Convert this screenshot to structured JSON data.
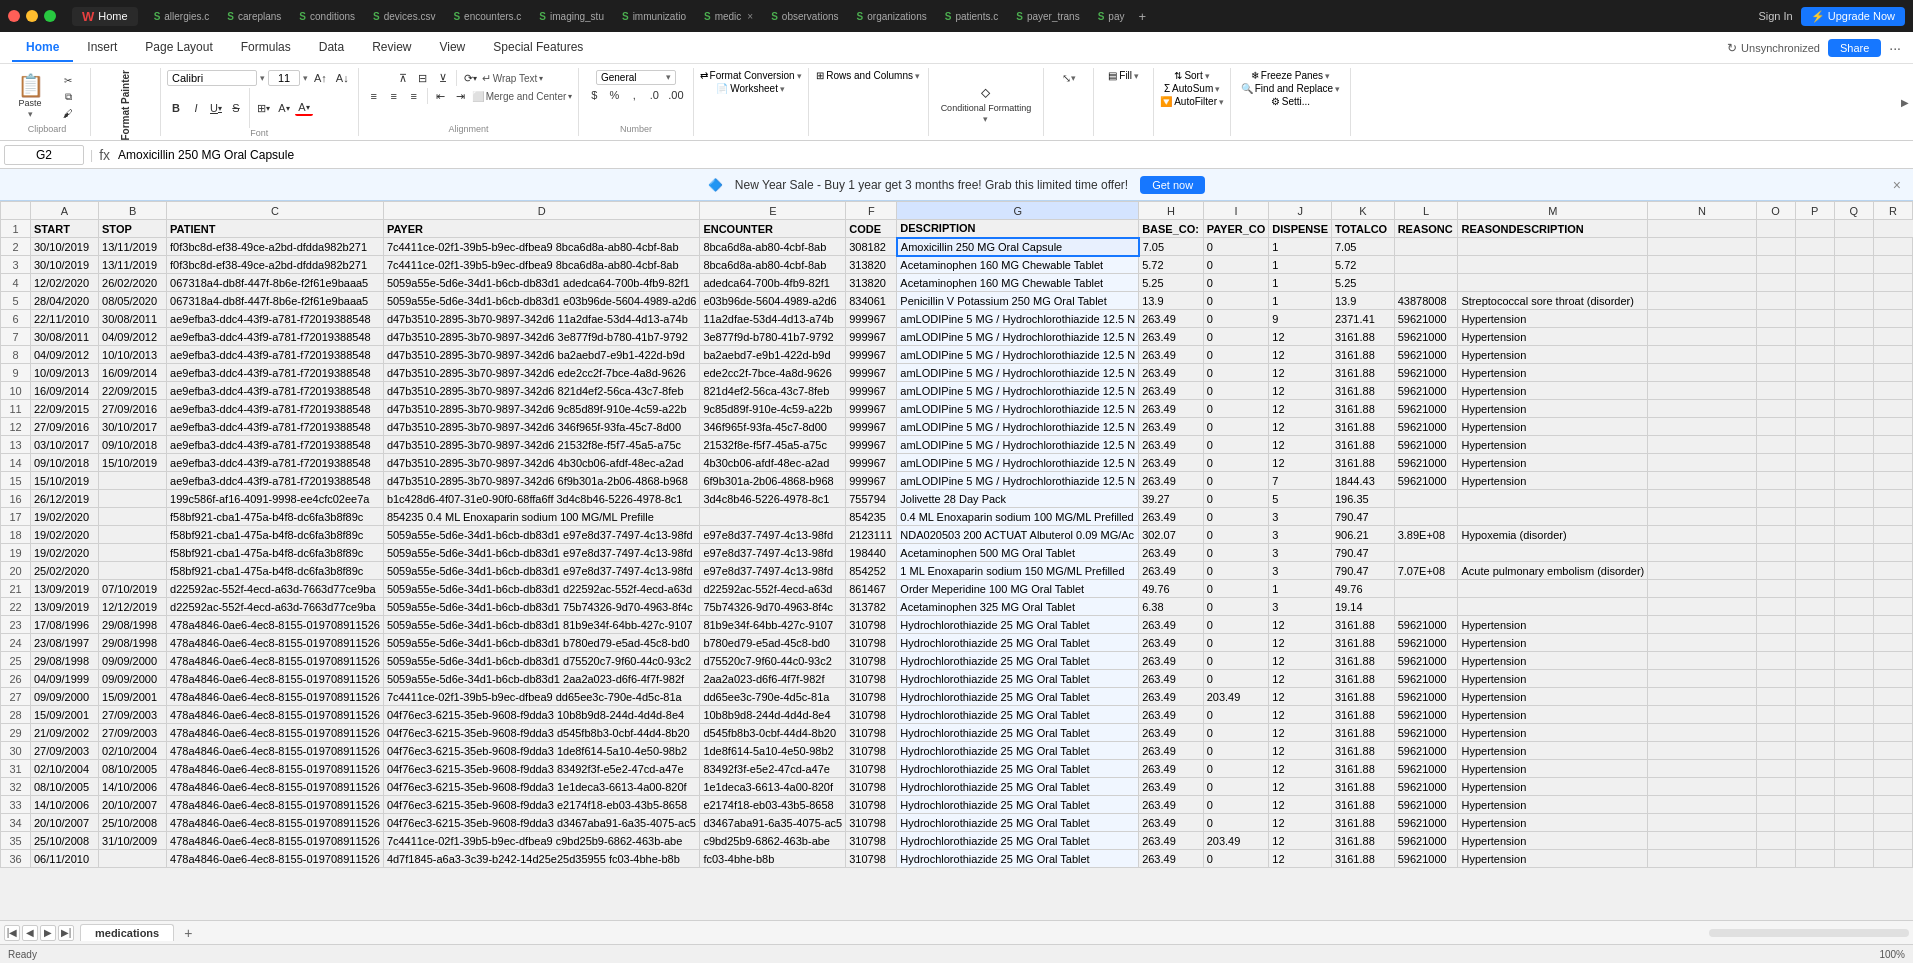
{
  "titleBar": {
    "trafficLights": [
      "red",
      "yellow",
      "green"
    ],
    "appName": "Home",
    "tabs": [
      {
        "id": "home",
        "label": "Home",
        "icon": "S",
        "active": true
      },
      {
        "id": "allergies",
        "label": "allergies.c",
        "icon": "S"
      },
      {
        "id": "careplans",
        "label": "careplans",
        "icon": "S"
      },
      {
        "id": "conditions",
        "label": "conditions",
        "icon": "S"
      },
      {
        "id": "devices",
        "label": "devices.csv",
        "icon": "S"
      },
      {
        "id": "encounters",
        "label": "encounters.c",
        "icon": "S"
      },
      {
        "id": "imaging_stu",
        "label": "imaging_stu",
        "icon": "S"
      },
      {
        "id": "immunization",
        "label": "immunizatio",
        "icon": "S"
      },
      {
        "id": "medic",
        "label": "medic",
        "icon": "S",
        "hasClose": true
      },
      {
        "id": "observations",
        "label": "observations",
        "icon": "S"
      },
      {
        "id": "organizations",
        "label": "organizations",
        "icon": "S"
      },
      {
        "id": "patients",
        "label": "patients.c",
        "icon": "S"
      },
      {
        "id": "payer_trans",
        "label": "payer_trans",
        "icon": "S"
      },
      {
        "id": "pay",
        "label": "pay",
        "icon": "S"
      }
    ],
    "signIn": "Sign In",
    "upgradeNow": "⚡ Upgrade Now"
  },
  "ribbonTabs": {
    "tabs": [
      "Home",
      "Insert",
      "Page Layout",
      "Formulas",
      "Data",
      "Review",
      "View",
      "Special Features"
    ],
    "activeTab": "Home",
    "unsyncLabel": "Unsynchronized",
    "shareLabel": "Share",
    "moreBtn": "···"
  },
  "ribbonGroups": {
    "formatPainter": "Format Painter",
    "paste": "Paste",
    "clipboard": "Clipboard",
    "fontName": "Calibri",
    "fontSize": "11",
    "bold": "B",
    "italic": "I",
    "underline": "U",
    "strikethrough": "S",
    "font": "Font",
    "wrapText": "Wrap Text",
    "mergeCenter": "Merge and Center",
    "alignment": "Alignment",
    "formatConversion": "Format Conversion",
    "worksheet": "Worksheet",
    "rowsAndColumns": "Rows and Columns",
    "conditionalFormatting": "Conditional Formatting",
    "fill": "Fill",
    "sort": "Sort",
    "autoSum": "AutoSum",
    "autoFilter": "AutoFilter",
    "freezePanes": "Freeze Panes",
    "findReplace": "Find and Replace",
    "settings": "Setti..."
  },
  "formulaBar": {
    "cellRef": "G2",
    "formula": "Amoxicillin 250 MG Oral Capsule"
  },
  "promoBanner": {
    "text": "🔷 New Year Sale - Buy 1 year get 3 months free! Grab this limited time offer!",
    "btnLabel": "Get now"
  },
  "columns": [
    "",
    "A",
    "B",
    "C",
    "D",
    "E",
    "F",
    "G",
    "H",
    "I",
    "J",
    "K",
    "L",
    "M",
    "N",
    "O",
    "P",
    "Q",
    "R"
  ],
  "headerRow": {
    "cells": [
      "",
      "START",
      "STOP",
      "PATIENT",
      "PAYER",
      "ENCOUNTER",
      "CODE",
      "DESCRIPTION",
      "BASE_CO:",
      "PAYER_CO",
      "DISPENSE",
      "TOTALCO",
      "REASONC",
      "REASONDESCRIPTION",
      "",
      "",
      "",
      "",
      ""
    ]
  },
  "rows": [
    [
      "2",
      "30/10/2019",
      "13/11/2019",
      "f0f3bc8d-ef38-49ce-a2bd-dfdda982b271",
      "7c4411ce-02f1-39b5-b9ec-dfbea9 8bca6d8a-ab80-4cbf-8ab",
      "8bca6d8a-ab80-4cbf-8ab",
      "308182",
      "Amoxicillin 250 MG Oral Capsule",
      "7.05",
      "0",
      "1",
      "7.05",
      "",
      "",
      "",
      "",
      "",
      "",
      ""
    ],
    [
      "3",
      "30/10/2019",
      "13/11/2019",
      "f0f3bc8d-ef38-49ce-a2bd-dfdda982b271",
      "7c4411ce-02f1-39b5-b9ec-dfbea9 8bca6d8a-ab80-4cbf-8ab",
      "8bca6d8a-ab80-4cbf-8ab",
      "313820",
      "Acetaminophen 160 MG Chewable Tablet",
      "5.72",
      "0",
      "1",
      "5.72",
      "",
      "",
      "",
      "",
      "",
      "",
      ""
    ],
    [
      "4",
      "12/02/2020",
      "26/02/2020",
      "067318a4-db8f-447f-8b6e-f2f61e9baaa5",
      "5059a55e-5d6e-34d1-b6cb-db83d1 adedca64-700b-4fb9-82f1",
      "adedca64-700b-4fb9-82f1",
      "313820",
      "Acetaminophen 160 MG Chewable Tablet",
      "5.25",
      "0",
      "1",
      "5.25",
      "",
      "",
      "",
      "",
      "",
      "",
      ""
    ],
    [
      "5",
      "28/04/2020",
      "08/05/2020",
      "067318a4-db8f-447f-8b6e-f2f61e9baaa5",
      "5059a55e-5d6e-34d1-b6cb-db83d1 e03b96de-5604-4989-a2d6",
      "e03b96de-5604-4989-a2d6",
      "834061",
      "Penicillin V Potassium 250 MG Oral Tablet",
      "13.9",
      "0",
      "1",
      "13.9",
      "43878008",
      "Streptococcal sore throat (disorder)",
      "",
      "",
      "",
      "",
      ""
    ],
    [
      "6",
      "22/11/2010",
      "30/08/2011",
      "ae9efba3-ddc4-43f9-a781-f72019388548",
      "d47b3510-2895-3b70-9897-342d6 11a2dfae-53d4-4d13-a74b",
      "11a2dfae-53d4-4d13-a74b",
      "999967",
      "amLODIPine 5 MG / Hydrochlorothiazide 12.5 N",
      "263.49",
      "0",
      "9",
      "2371.41",
      "59621000",
      "Hypertension",
      "",
      "",
      "",
      "",
      ""
    ],
    [
      "7",
      "30/08/2011",
      "04/09/2012",
      "ae9efba3-ddc4-43f9-a781-f72019388548",
      "d47b3510-2895-3b70-9897-342d6 3e877f9d-b780-41b7-9792",
      "3e877f9d-b780-41b7-9792",
      "999967",
      "amLODIPine 5 MG / Hydrochlorothiazide 12.5 N",
      "263.49",
      "0",
      "12",
      "3161.88",
      "59621000",
      "Hypertension",
      "",
      "",
      "",
      "",
      ""
    ],
    [
      "8",
      "04/09/2012",
      "10/10/2013",
      "ae9efba3-ddc4-43f9-a781-f72019388548",
      "d47b3510-2895-3b70-9897-342d6 ba2aebd7-e9b1-422d-b9d",
      "ba2aebd7-e9b1-422d-b9d",
      "999967",
      "amLODIPine 5 MG / Hydrochlorothiazide 12.5 N",
      "263.49",
      "0",
      "12",
      "3161.88",
      "59621000",
      "Hypertension",
      "",
      "",
      "",
      "",
      ""
    ],
    [
      "9",
      "10/09/2013",
      "16/09/2014",
      "ae9efba3-ddc4-43f9-a781-f72019388548",
      "d47b3510-2895-3b70-9897-342d6 ede2cc2f-7bce-4a8d-9626",
      "ede2cc2f-7bce-4a8d-9626",
      "999967",
      "amLODIPine 5 MG / Hydrochlorothiazide 12.5 N",
      "263.49",
      "0",
      "12",
      "3161.88",
      "59621000",
      "Hypertension",
      "",
      "",
      "",
      "",
      ""
    ],
    [
      "10",
      "16/09/2014",
      "22/09/2015",
      "ae9efba3-ddc4-43f9-a781-f72019388548",
      "d47b3510-2895-3b70-9897-342d6 821d4ef2-56ca-43c7-8feb",
      "821d4ef2-56ca-43c7-8feb",
      "999967",
      "amLODIPine 5 MG / Hydrochlorothiazide 12.5 N",
      "263.49",
      "0",
      "12",
      "3161.88",
      "59621000",
      "Hypertension",
      "",
      "",
      "",
      "",
      ""
    ],
    [
      "11",
      "22/09/2015",
      "27/09/2016",
      "ae9efba3-ddc4-43f9-a781-f72019388548",
      "d47b3510-2895-3b70-9897-342d6 9c85d89f-910e-4c59-a22b",
      "9c85d89f-910e-4c59-a22b",
      "999967",
      "amLODIPine 5 MG / Hydrochlorothiazide 12.5 N",
      "263.49",
      "0",
      "12",
      "3161.88",
      "59621000",
      "Hypertension",
      "",
      "",
      "",
      "",
      ""
    ],
    [
      "12",
      "27/09/2016",
      "30/10/2017",
      "ae9efba3-ddc4-43f9-a781-f72019388548",
      "d47b3510-2895-3b70-9897-342d6 346f965f-93fa-45c7-8d00",
      "346f965f-93fa-45c7-8d00",
      "999967",
      "amLODIPine 5 MG / Hydrochlorothiazide 12.5 N",
      "263.49",
      "0",
      "12",
      "3161.88",
      "59621000",
      "Hypertension",
      "",
      "",
      "",
      "",
      ""
    ],
    [
      "13",
      "03/10/2017",
      "09/10/2018",
      "ae9efba3-ddc4-43f9-a781-f72019388548",
      "d47b3510-2895-3b70-9897-342d6 21532f8e-f5f7-45a5-a75c",
      "21532f8e-f5f7-45a5-a75c",
      "999967",
      "amLODIPine 5 MG / Hydrochlorothiazide 12.5 N",
      "263.49",
      "0",
      "12",
      "3161.88",
      "59621000",
      "Hypertension",
      "",
      "",
      "",
      "",
      ""
    ],
    [
      "14",
      "09/10/2018",
      "15/10/2019",
      "ae9efba3-ddc4-43f9-a781-f72019388548",
      "d47b3510-2895-3b70-9897-342d6 4b30cb06-afdf-48ec-a2ad",
      "4b30cb06-afdf-48ec-a2ad",
      "999967",
      "amLODIPine 5 MG / Hydrochlorothiazide 12.5 N",
      "263.49",
      "0",
      "12",
      "3161.88",
      "59621000",
      "Hypertension",
      "",
      "",
      "",
      "",
      ""
    ],
    [
      "15",
      "15/10/2019",
      "",
      "ae9efba3-ddc4-43f9-a781-f72019388548",
      "d47b3510-2895-3b70-9897-342d6 6f9b301a-2b06-4868-b968",
      "6f9b301a-2b06-4868-b968",
      "999967",
      "amLODIPine 5 MG / Hydrochlorothiazide 12.5 N",
      "263.49",
      "0",
      "7",
      "1844.43",
      "59621000",
      "Hypertension",
      "",
      "",
      "",
      "",
      ""
    ],
    [
      "16",
      "26/12/2019",
      "",
      "199c586f-af16-4091-9998-ee4cfc02ee7a",
      "b1c428d6-4f07-31e0-90f0-68ffa6ff 3d4c8b46-5226-4978-8c1",
      "3d4c8b46-5226-4978-8c1",
      "755794",
      "Jolivette 28 Day Pack",
      "39.27",
      "0",
      "5",
      "196.35",
      "",
      "",
      "",
      "",
      "",
      "",
      ""
    ],
    [
      "17",
      "19/02/2020",
      "",
      "f58bf921-cba1-475a-b4f8-dc6fa3b8f89c",
      "854235 0.4 ML Enoxaparin sodium 100 MG/ML Prefille",
      "",
      "854235",
      "0.4 ML Enoxaparin sodium 100 MG/ML Prefilled",
      "263.49",
      "0",
      "3",
      "790.47",
      "",
      "",
      "",
      "",
      "",
      "",
      ""
    ],
    [
      "18",
      "19/02/2020",
      "",
      "f58bf921-cba1-475a-b4f8-dc6fa3b8f89c",
      "5059a55e-5d6e-34d1-b6cb-db83d1 e97e8d37-7497-4c13-98fd",
      "e97e8d37-7497-4c13-98fd",
      "2123111",
      "NDA020503 200 ACTUAT Albuterol 0.09 MG/Ac",
      "302.07",
      "0",
      "3",
      "906.21",
      "3.89E+08",
      "Hypoxemia (disorder)",
      "",
      "",
      "",
      "",
      ""
    ],
    [
      "19",
      "19/02/2020",
      "",
      "f58bf921-cba1-475a-b4f8-dc6fa3b8f89c",
      "5059a55e-5d6e-34d1-b6cb-db83d1 e97e8d37-7497-4c13-98fd",
      "e97e8d37-7497-4c13-98fd",
      "198440",
      "Acetaminophen 500 MG Oral Tablet",
      "263.49",
      "0",
      "3",
      "790.47",
      "",
      "",
      "",
      "",
      "",
      "",
      ""
    ],
    [
      "20",
      "25/02/2020",
      "",
      "f58bf921-cba1-475a-b4f8-dc6fa3b8f89c",
      "5059a55e-5d6e-34d1-b6cb-db83d1 e97e8d37-7497-4c13-98fd",
      "e97e8d37-7497-4c13-98fd",
      "854252",
      "1 ML Enoxaparin sodium 150 MG/ML Prefilled",
      "263.49",
      "0",
      "3",
      "790.47",
      "7.07E+08",
      "Acute pulmonary embolism (disorder)",
      "",
      "",
      "",
      "",
      ""
    ],
    [
      "21",
      "13/09/2019",
      "07/10/2019",
      "d22592ac-552f-4ecd-a63d-7663d77ce9ba",
      "5059a55e-5d6e-34d1-b6cb-db83d1 d22592ac-552f-4ecd-a63d",
      "d22592ac-552f-4ecd-a63d",
      "861467",
      "Order Meperidine 100 MG Oral Tablet",
      "49.76",
      "0",
      "1",
      "49.76",
      "",
      "",
      "",
      "",
      "",
      "",
      ""
    ],
    [
      "22",
      "13/09/2019",
      "12/12/2019",
      "d22592ac-552f-4ecd-a63d-7663d77ce9ba",
      "5059a55e-5d6e-34d1-b6cb-db83d1 75b74326-9d70-4963-8f4c",
      "75b74326-9d70-4963-8f4c",
      "313782",
      "Acetaminophen 325 MG Oral Tablet",
      "6.38",
      "0",
      "3",
      "19.14",
      "",
      "",
      "",
      "",
      "",
      "",
      ""
    ],
    [
      "23",
      "17/08/1996",
      "29/08/1998",
      "478a4846-0ae6-4ec8-8155-019708911526",
      "5059a55e-5d6e-34d1-b6cb-db83d1 81b9e34f-64bb-427c-9107",
      "81b9e34f-64bb-427c-9107",
      "310798",
      "Hydrochlorothiazide 25 MG Oral Tablet",
      "263.49",
      "0",
      "12",
      "3161.88",
      "59621000",
      "Hypertension",
      "",
      "",
      "",
      "",
      ""
    ],
    [
      "24",
      "23/08/1997",
      "29/08/1998",
      "478a4846-0ae6-4ec8-8155-019708911526",
      "5059a55e-5d6e-34d1-b6cb-db83d1 b780ed79-e5ad-45c8-bd0",
      "b780ed79-e5ad-45c8-bd0",
      "310798",
      "Hydrochlorothiazide 25 MG Oral Tablet",
      "263.49",
      "0",
      "12",
      "3161.88",
      "59621000",
      "Hypertension",
      "",
      "",
      "",
      "",
      ""
    ],
    [
      "25",
      "29/08/1998",
      "09/09/2000",
      "478a4846-0ae6-4ec8-8155-019708911526",
      "5059a55e-5d6e-34d1-b6cb-db83d1 d75520c7-9f60-44c0-93c2",
      "d75520c7-9f60-44c0-93c2",
      "310798",
      "Hydrochlorothiazide 25 MG Oral Tablet",
      "263.49",
      "0",
      "12",
      "3161.88",
      "59621000",
      "Hypertension",
      "",
      "",
      "",
      "",
      ""
    ],
    [
      "26",
      "04/09/1999",
      "09/09/2000",
      "478a4846-0ae6-4ec8-8155-019708911526",
      "5059a55e-5d6e-34d1-b6cb-db83d1 2aa2a023-d6f6-4f7f-982f",
      "2aa2a023-d6f6-4f7f-982f",
      "310798",
      "Hydrochlorothiazide 25 MG Oral Tablet",
      "263.49",
      "0",
      "12",
      "3161.88",
      "59621000",
      "Hypertension",
      "",
      "",
      "",
      "",
      ""
    ],
    [
      "27",
      "09/09/2000",
      "15/09/2001",
      "478a4846-0ae6-4ec8-8155-019708911526",
      "7c4411ce-02f1-39b5-b9ec-dfbea9 dd65ee3c-790e-4d5c-81a",
      "dd65ee3c-790e-4d5c-81a",
      "310798",
      "Hydrochlorothiazide 25 MG Oral Tablet",
      "263.49",
      "203.49",
      "12",
      "3161.88",
      "59621000",
      "Hypertension",
      "",
      "",
      "",
      "",
      ""
    ],
    [
      "28",
      "15/09/2001",
      "27/09/2003",
      "478a4846-0ae6-4ec8-8155-019708911526",
      "04f76ec3-6215-35eb-9608-f9dda3 10b8b9d8-244d-4d4d-8e4",
      "10b8b9d8-244d-4d4d-8e4",
      "310798",
      "Hydrochlorothiazide 25 MG Oral Tablet",
      "263.49",
      "0",
      "12",
      "3161.88",
      "59621000",
      "Hypertension",
      "",
      "",
      "",
      "",
      ""
    ],
    [
      "29",
      "21/09/2002",
      "27/09/2003",
      "478a4846-0ae6-4ec8-8155-019708911526",
      "04f76ec3-6215-35eb-9608-f9dda3 d545fb8b3-0cbf-44d4-8b20",
      "d545fb8b3-0cbf-44d4-8b20",
      "310798",
      "Hydrochlorothiazide 25 MG Oral Tablet",
      "263.49",
      "0",
      "12",
      "3161.88",
      "59621000",
      "Hypertension",
      "",
      "",
      "",
      "",
      ""
    ],
    [
      "30",
      "27/09/2003",
      "02/10/2004",
      "478a4846-0ae6-4ec8-8155-019708911526",
      "04f76ec3-6215-35eb-9608-f9dda3 1de8f614-5a10-4e50-98b2",
      "1de8f614-5a10-4e50-98b2",
      "310798",
      "Hydrochlorothiazide 25 MG Oral Tablet",
      "263.49",
      "0",
      "12",
      "3161.88",
      "59621000",
      "Hypertension",
      "",
      "",
      "",
      "",
      ""
    ],
    [
      "31",
      "02/10/2004",
      "08/10/2005",
      "478a4846-0ae6-4ec8-8155-019708911526",
      "04f76ec3-6215-35eb-9608-f9dda3 83492f3f-e5e2-47cd-a47e",
      "83492f3f-e5e2-47cd-a47e",
      "310798",
      "Hydrochlorothiazide 25 MG Oral Tablet",
      "263.49",
      "0",
      "12",
      "3161.88",
      "59621000",
      "Hypertension",
      "",
      "",
      "",
      "",
      ""
    ],
    [
      "32",
      "08/10/2005",
      "14/10/2006",
      "478a4846-0ae6-4ec8-8155-019708911526",
      "04f76ec3-6215-35eb-9608-f9dda3 1e1deca3-6613-4a00-820f",
      "1e1deca3-6613-4a00-820f",
      "310798",
      "Hydrochlorothiazide 25 MG Oral Tablet",
      "263.49",
      "0",
      "12",
      "3161.88",
      "59621000",
      "Hypertension",
      "",
      "",
      "",
      "",
      ""
    ],
    [
      "33",
      "14/10/2006",
      "20/10/2007",
      "478a4846-0ae6-4ec8-8155-019708911526",
      "04f76ec3-6215-35eb-9608-f9dda3 e2174f18-eb03-43b5-8658",
      "e2174f18-eb03-43b5-8658",
      "310798",
      "Hydrochlorothiazide 25 MG Oral Tablet",
      "263.49",
      "0",
      "12",
      "3161.88",
      "59621000",
      "Hypertension",
      "",
      "",
      "",
      "",
      ""
    ],
    [
      "34",
      "20/10/2007",
      "25/10/2008",
      "478a4846-0ae6-4ec8-8155-019708911526",
      "04f76ec3-6215-35eb-9608-f9dda3 d3467aba91-6a35-4075-ac5",
      "d3467aba91-6a35-4075-ac5",
      "310798",
      "Hydrochlorothiazide 25 MG Oral Tablet",
      "263.49",
      "0",
      "12",
      "3161.88",
      "59621000",
      "Hypertension",
      "",
      "",
      "",
      "",
      ""
    ],
    [
      "35",
      "25/10/2008",
      "31/10/2009",
      "478a4846-0ae6-4ec8-8155-019708911526",
      "7c4411ce-02f1-39b5-b9ec-dfbea9 c9bd25b9-6862-463b-abe",
      "c9bd25b9-6862-463b-abe",
      "310798",
      "Hydrochlorothiazide 25 MG Oral Tablet",
      "263.49",
      "203.49",
      "12",
      "3161.88",
      "59621000",
      "Hypertension",
      "",
      "",
      "",
      "",
      ""
    ],
    [
      "36",
      "06/11/2010",
      "",
      "478a4846-0ae6-4ec8-8155-019708911526",
      "4d7f1845-a6a3-3c39-b242-14d25e25d35955 fc03-4bhe-b8b",
      "fc03-4bhe-b8b",
      "310798",
      "Hydrochlorothiazide 25 MG Oral Tablet",
      "263.49",
      "0",
      "12",
      "3161.88",
      "59621000",
      "Hypertension",
      "",
      "",
      "",
      "",
      ""
    ]
  ],
  "sheetTabs": {
    "tabs": [
      "medications"
    ],
    "activeTab": "medications",
    "addBtn": "+"
  },
  "statusBar": {
    "zoom": "100%"
  }
}
